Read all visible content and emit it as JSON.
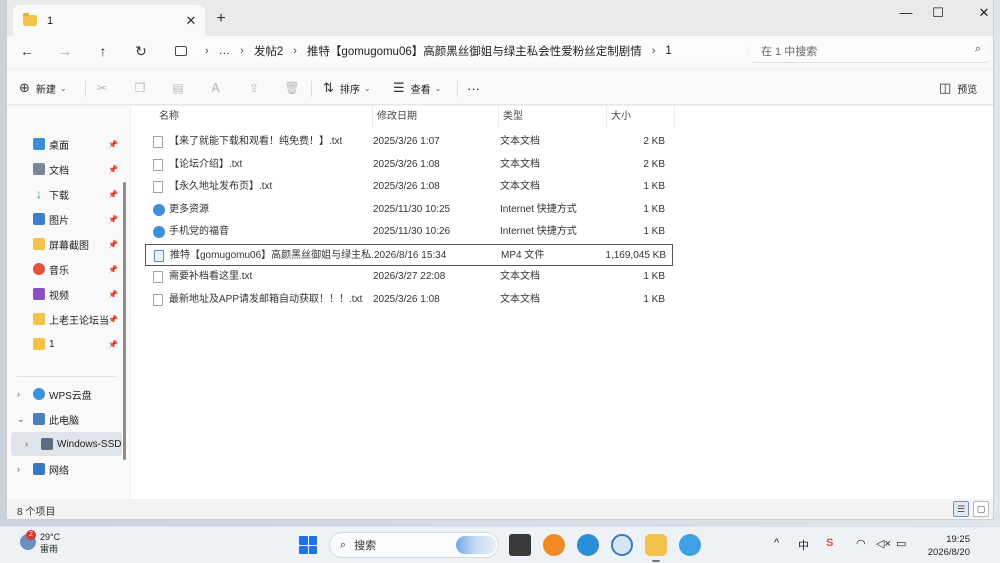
{
  "window": {
    "tab_title": "1",
    "tab_close": "✕",
    "new_tab": "+",
    "controls": {
      "minimize": "—",
      "maximize": "☐",
      "close": "✕"
    }
  },
  "nav": {
    "back": "←",
    "forward": "→",
    "up": "↑",
    "refresh": "↻",
    "breadcrumb": [
      "…",
      "发帖2",
      "推特【gomugomu06】高颜黑丝御姐与绿主私会性爱粉丝定制剧情",
      "1"
    ],
    "search_placeholder": "在 1 中搜索"
  },
  "commands": {
    "new": "新建",
    "sort": "排序",
    "view": "查看",
    "more": "···",
    "preview": "预览"
  },
  "sidebar": {
    "quick_access": [
      {
        "label": "桌面",
        "icon": "desktop-icon",
        "color": "#3b8fd9"
      },
      {
        "label": "文档",
        "icon": "document-icon",
        "color": "#7a8797"
      },
      {
        "label": "下载",
        "icon": "download-icon",
        "color": "#2b8a5a"
      },
      {
        "label": "图片",
        "icon": "picture-icon",
        "color": "#3b7fd1"
      },
      {
        "label": "屏幕截图",
        "icon": "folder-icon",
        "color": "#f3c24a"
      },
      {
        "label": "音乐",
        "icon": "music-icon",
        "color": "#e0533d"
      },
      {
        "label": "视频",
        "icon": "video-icon",
        "color": "#8a4fc4"
      },
      {
        "label": "上老王论坛当",
        "icon": "folder-icon",
        "color": "#f3c24a"
      },
      {
        "label": "1",
        "icon": "folder-icon",
        "color": "#f3c24a"
      }
    ],
    "tree": [
      {
        "label": "WPS云盘",
        "icon": "cloud-icon",
        "expander": "›"
      },
      {
        "label": "此电脑",
        "icon": "computer-icon",
        "expander": "⌄"
      },
      {
        "label": "Windows-SSD",
        "icon": "drive-icon",
        "expander": "›"
      },
      {
        "label": "网络",
        "icon": "network-icon",
        "expander": "›"
      }
    ]
  },
  "columns": {
    "name": "名称",
    "modified": "修改日期",
    "type": "类型",
    "size": "大小"
  },
  "files": [
    {
      "name": "【来了就能下载和观看！纯免费！】.txt",
      "modified": "2025/3/26 1:07",
      "type": "文本文档",
      "size": "2 KB",
      "icon": "txt"
    },
    {
      "name": "【论坛介绍】.txt",
      "modified": "2025/3/26 1:08",
      "type": "文本文档",
      "size": "2 KB",
      "icon": "txt"
    },
    {
      "name": "【永久地址发布页】.txt",
      "modified": "2025/3/26 1:08",
      "type": "文本文档",
      "size": "1 KB",
      "icon": "txt"
    },
    {
      "name": "更多资源",
      "modified": "2025/11/30 10:25",
      "type": "Internet 快捷方式",
      "size": "1 KB",
      "icon": "url"
    },
    {
      "name": "手机党的福音",
      "modified": "2025/11/30 10:26",
      "type": "Internet 快捷方式",
      "size": "1 KB",
      "icon": "url"
    },
    {
      "name": "推特【gomugomu06】高颜黑丝御姐与绿主私...",
      "modified": "2026/8/16 15:34",
      "type": "MP4 文件",
      "size": "1,169,045 KB",
      "icon": "mp4"
    },
    {
      "name": "需要补档看这里.txt",
      "modified": "2026/3/27 22:08",
      "type": "文本文档",
      "size": "1 KB",
      "icon": "txt"
    },
    {
      "name": "最新地址及APP请发邮箱自动获取！！！.txt",
      "modified": "2025/3/26 1:08",
      "type": "文本文档",
      "size": "1 KB",
      "icon": "txt"
    }
  ],
  "status": {
    "item_count": "8 个项目"
  },
  "taskbar": {
    "weather_badge": "2",
    "temperature": "29°C",
    "condition": "雷雨",
    "search_label": "搜索",
    "tray": {
      "chevron": "^",
      "ime": "中",
      "wifi": "wifi-icon",
      "volume": "volume-icon",
      "battery": "battery-icon"
    },
    "time": "19:25",
    "date": "2026/8/20"
  }
}
